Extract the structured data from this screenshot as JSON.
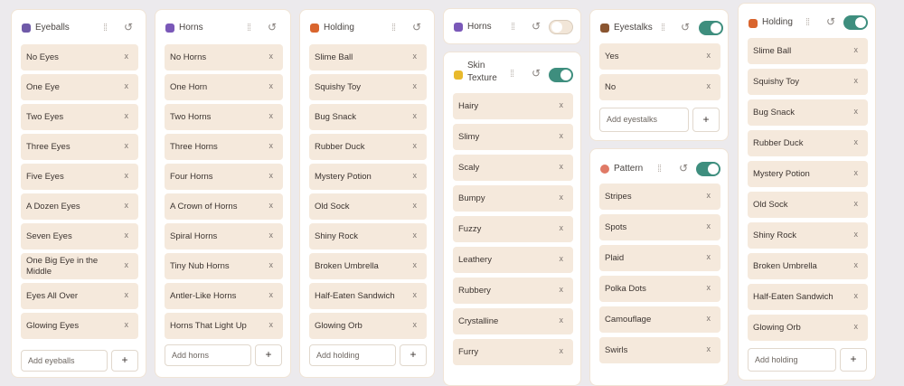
{
  "panels": {
    "eyeballs": {
      "title": "Eyeballs",
      "input_placeholder": "Add eyeballs",
      "add_label": "+",
      "items": [
        "No Eyes",
        "One Eye",
        "Two Eyes",
        "Three Eyes",
        "Five Eyes",
        "A Dozen Eyes",
        "Seven Eyes",
        "One Big Eye in the Middle",
        "Eyes All Over",
        "Glowing Eyes"
      ]
    },
    "horns": {
      "title": "Horns",
      "input_placeholder": "Add horns",
      "add_label": "+",
      "items": [
        "No Horns",
        "One Horn",
        "Two Horns",
        "Three Horns",
        "Four Horns",
        "A Crown of Horns",
        "Spiral Horns",
        "Tiny Nub Horns",
        "Antler-Like Horns",
        "Horns That Light Up"
      ]
    },
    "holding": {
      "title": "Holding",
      "input_placeholder": "Add holding",
      "add_label": "+",
      "items": [
        "Slime Ball",
        "Squishy Toy",
        "Bug Snack",
        "Rubber Duck",
        "Mystery Potion",
        "Old Sock",
        "Shiny Rock",
        "Broken Umbrella",
        "Half-Eaten Sandwich",
        "Glowing Orb"
      ]
    },
    "horns_collapsed": {
      "title": "Horns",
      "enabled": false
    },
    "skin_texture": {
      "title": "Skin Texture",
      "enabled": true,
      "items": [
        "Hairy",
        "Slimy",
        "Scaly",
        "Bumpy",
        "Fuzzy",
        "Leathery",
        "Rubbery",
        "Crystalline",
        "Furry"
      ]
    },
    "eyestalks": {
      "title": "Eyestalks",
      "enabled": true,
      "input_placeholder": "Add eyestalks",
      "add_label": "+",
      "items": [
        "Yes",
        "No"
      ]
    },
    "pattern": {
      "title": "Pattern",
      "enabled": true,
      "items": [
        "Stripes",
        "Spots",
        "Plaid",
        "Polka Dots",
        "Camouflage",
        "Swirls"
      ]
    },
    "holding_2": {
      "title": "Holding",
      "enabled": true,
      "input_placeholder": "Add holding",
      "add_label": "+",
      "items": [
        "Slime Ball",
        "Squishy Toy",
        "Bug Snack",
        "Rubber Duck",
        "Mystery Potion",
        "Old Sock",
        "Shiny Rock",
        "Broken Umbrella",
        "Half-Eaten Sandwich",
        "Glowing Orb"
      ]
    }
  },
  "icons": {
    "grip": "grip-icon",
    "reset": "reset-icon",
    "remove": "x-icon"
  },
  "glyphs": {
    "grip": "⁞⁞",
    "reset": "↺",
    "remove": "x"
  },
  "colors": {
    "accent": "#3e8e7e",
    "item_bg": "#f5e9dc",
    "panel_border": "#f0e4d6",
    "background": "#eceaed"
  }
}
